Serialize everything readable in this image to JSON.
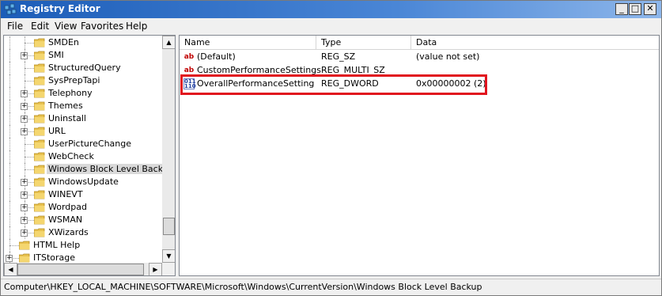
{
  "window": {
    "title": "Registry Editor",
    "min_glyph": "_",
    "max_glyph": "□",
    "close_glyph": "✕"
  },
  "menu": [
    "File",
    "Edit",
    "View",
    "Favorites",
    "Help"
  ],
  "tree": {
    "items": [
      {
        "label": "SMDEn",
        "expandable": false,
        "level": 1
      },
      {
        "label": "SMI",
        "expandable": true,
        "level": 1
      },
      {
        "label": "StructuredQuery",
        "expandable": false,
        "level": 1
      },
      {
        "label": "SysPrepTapi",
        "expandable": false,
        "level": 1
      },
      {
        "label": "Telephony",
        "expandable": true,
        "level": 1
      },
      {
        "label": "Themes",
        "expandable": true,
        "level": 1
      },
      {
        "label": "Uninstall",
        "expandable": true,
        "level": 1
      },
      {
        "label": "URL",
        "expandable": true,
        "level": 1
      },
      {
        "label": "UserPictureChange",
        "expandable": false,
        "level": 1
      },
      {
        "label": "WebCheck",
        "expandable": false,
        "level": 1
      },
      {
        "label": "Windows Block Level Backup",
        "expandable": false,
        "level": 1,
        "selected": true
      },
      {
        "label": "WindowsUpdate",
        "expandable": true,
        "level": 1
      },
      {
        "label": "WINEVT",
        "expandable": true,
        "level": 1
      },
      {
        "label": "Wordpad",
        "expandable": true,
        "level": 1
      },
      {
        "label": "WSMAN",
        "expandable": true,
        "level": 1
      },
      {
        "label": "XWizards",
        "expandable": true,
        "level": 1
      },
      {
        "label": "HTML Help",
        "expandable": false,
        "level": 0
      },
      {
        "label": "ITStorage",
        "expandable": true,
        "level": 0
      }
    ]
  },
  "list": {
    "columns": [
      "Name",
      "Type",
      "Data"
    ],
    "rows": [
      {
        "icon": "string-value-icon",
        "icon_text": "ab",
        "name": "(Default)",
        "type": "REG_SZ",
        "data": "(value not set)"
      },
      {
        "icon": "string-value-icon",
        "icon_text": "ab",
        "name": "CustomPerformanceSettings",
        "type": "REG_MULTI_SZ",
        "data": ""
      },
      {
        "icon": "dword-value-icon",
        "icon_text": "011\n110",
        "name": "OverallPerformanceSetting",
        "type": "REG_DWORD",
        "data": "0x00000002 (2)",
        "highlighted": true
      }
    ]
  },
  "status": {
    "path": "Computer\\HKEY_LOCAL_MACHINE\\SOFTWARE\\Microsoft\\Windows\\CurrentVersion\\Windows Block Level Backup"
  },
  "colors": {
    "highlight_border": "#e1141e",
    "titlebar": "#1c5db8",
    "folder": "#e8c24f"
  }
}
